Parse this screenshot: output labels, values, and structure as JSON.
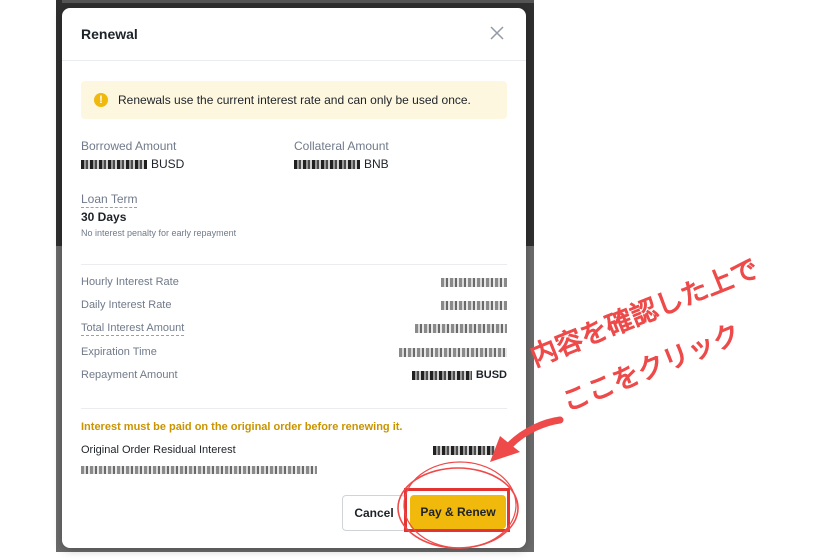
{
  "modal": {
    "title": "Renewal",
    "notice": "Renewals use the current interest rate and can only be used once.",
    "borrowed": {
      "label": "Borrowed Amount",
      "currency": "BUSD"
    },
    "collateral": {
      "label": "Collateral Amount",
      "currency": "BNB"
    },
    "loan_term": {
      "label": "Loan Term",
      "value": "30 Days",
      "note": "No interest penalty for early repayment"
    },
    "rows": [
      {
        "label": "Hourly Interest Rate",
        "suffix": ""
      },
      {
        "label": "Daily Interest Rate",
        "suffix": ""
      },
      {
        "label": "Total Interest Amount",
        "suffix": ""
      },
      {
        "label": "Expiration Time",
        "suffix": ""
      },
      {
        "label": "Repayment Amount",
        "suffix": "BUSD"
      }
    ],
    "warning": "Interest must be paid on the original order before renewing it.",
    "original_interest": {
      "label": "Original Order Residual Interest",
      "suffix": "B"
    },
    "cancel_label": "Cancel",
    "pay_label": "Pay & Renew"
  },
  "annotation": {
    "line1": "内容を確認した上で",
    "line2": "ここをクリック",
    "color": "#ef4a4a"
  },
  "colors": {
    "accent": "#f0b90b",
    "warning_text": "#c99400",
    "notice_bg": "#fdf7e0"
  }
}
